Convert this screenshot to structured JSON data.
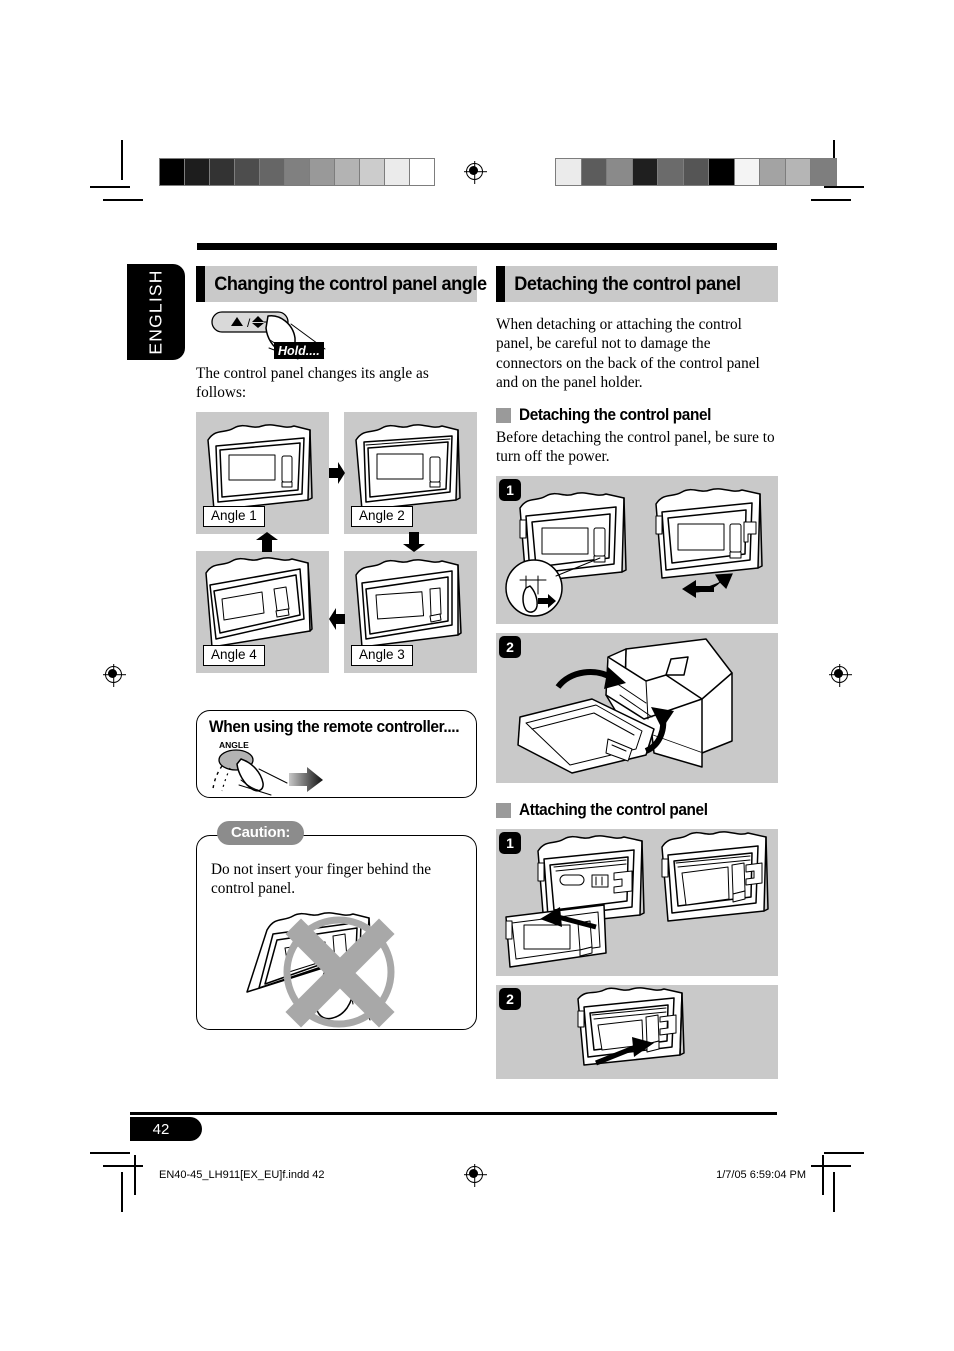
{
  "document": {
    "language_tab": "ENGLISH",
    "page_number": "42",
    "footer_file": "EN40-45_LH911[EX_EU]f.indd   42",
    "footer_timestamp": "1/7/05   6:59:04 PM"
  },
  "left_column": {
    "section_title": "Changing the control panel angle",
    "hold_label": "Hold....",
    "button_symbol": "▲ / ⇕",
    "intro": "The control panel changes its angle as follows:",
    "angles": [
      {
        "label": "Angle 1"
      },
      {
        "label": "Angle 2"
      },
      {
        "label": "Angle 3"
      },
      {
        "label": "Angle 4"
      }
    ],
    "remote_box": {
      "title": "When using the remote controller....",
      "button_label": "ANGLE"
    },
    "caution_box": {
      "badge": "Caution:",
      "text": "Do not insert your finger behind the control panel."
    }
  },
  "right_column": {
    "section_title": "Detaching the control panel",
    "intro": "When detaching or attaching the control panel, be careful not to damage the connectors on the back of the control panel and on the panel holder.",
    "detaching": {
      "heading": "Detaching the control panel",
      "text": "Before detaching the control panel, be sure to turn off the power.",
      "steps": [
        {
          "number": "1"
        },
        {
          "number": "2"
        }
      ]
    },
    "attaching": {
      "heading": "Attaching the control panel",
      "steps": [
        {
          "number": "1"
        },
        {
          "number": "2"
        }
      ]
    }
  },
  "print_marks": {
    "grayscale_bar_left": [
      "#000000",
      "#1d1d1d",
      "#333333",
      "#4d4d4d",
      "#666666",
      "#808080",
      "#999999",
      "#b3b3b3",
      "#cccccc",
      "#ebebeb",
      "#ffffff"
    ],
    "grayscale_bar_right": [
      "#ebebeb",
      "#5c5c5c",
      "#8a8a8a",
      "#1f1f1f",
      "#6b6b6b",
      "#555555",
      "#000000",
      "#f4f4f4",
      "#a3a3a3",
      "#b5b5b5",
      "#7e7e7e"
    ]
  },
  "colors": {
    "panel_gray": "#c9c9c9",
    "header_gray": "#c9c9c9",
    "accent_black": "#000000",
    "caution_gray": "#8c8c8c"
  }
}
